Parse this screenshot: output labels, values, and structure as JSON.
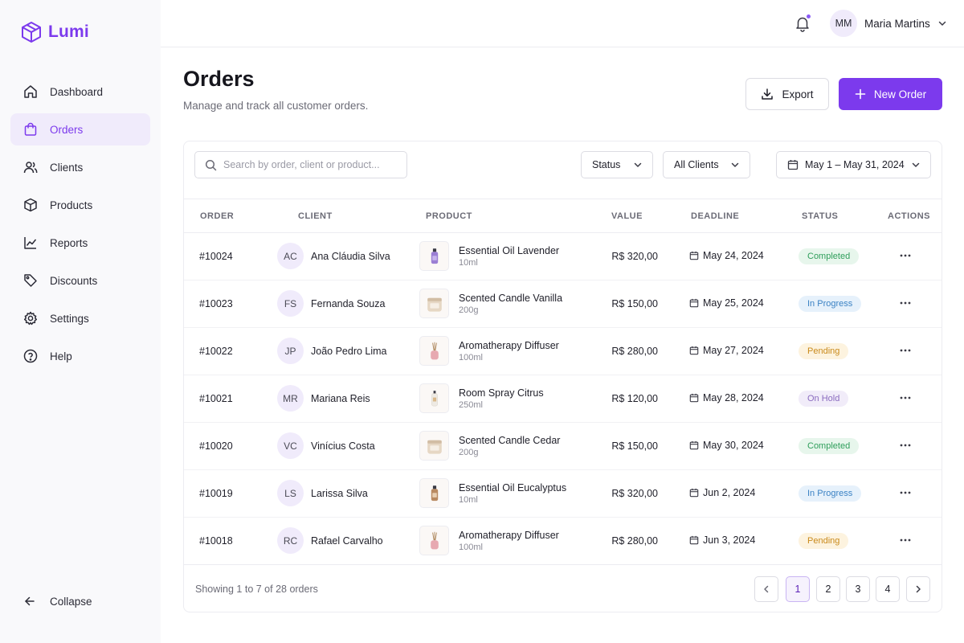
{
  "app": {
    "name": "Lumi"
  },
  "sidebar": {
    "items": [
      {
        "label": "Dashboard",
        "icon": "home-icon"
      },
      {
        "label": "Orders",
        "icon": "shopping-bag-icon",
        "active": true
      },
      {
        "label": "Clients",
        "icon": "users-icon"
      },
      {
        "label": "Products",
        "icon": "box-icon"
      },
      {
        "label": "Reports",
        "icon": "chart-icon"
      },
      {
        "label": "Discounts",
        "icon": "tag-icon"
      },
      {
        "label": "Settings",
        "icon": "gear-icon"
      },
      {
        "label": "Help",
        "icon": "help-circle-icon"
      }
    ],
    "collapse_label": "Collapse"
  },
  "header": {
    "user": {
      "initials": "MM",
      "name": "Maria Martins"
    }
  },
  "page": {
    "title": "Orders",
    "subtitle": "Manage and track all customer orders.",
    "export_label": "Export",
    "new_order_label": "New Order"
  },
  "filters": {
    "search_placeholder": "Search by order, client or product...",
    "status_label": "Status",
    "clients_label": "All Clients",
    "date_range": "May 1 – May 31, 2024"
  },
  "table": {
    "columns": [
      "ORDER",
      "CLIENT",
      "PRODUCT",
      "VALUE",
      "DEADLINE",
      "STATUS",
      "ACTIONS"
    ],
    "rows": [
      {
        "order": "#10024",
        "initials": "AC",
        "client": "Ana Cláudia Silva",
        "product": "Essential Oil Lavender",
        "size": "10ml",
        "value": "R$ 320,00",
        "deadline": "May 24, 2024",
        "status": "Completed",
        "thumb": "oil-lavender"
      },
      {
        "order": "#10023",
        "initials": "FS",
        "client": "Fernanda Souza",
        "product": "Scented Candle Vanilla",
        "size": "200g",
        "value": "R$ 150,00",
        "deadline": "May 25, 2024",
        "status": "In Progress",
        "thumb": "candle"
      },
      {
        "order": "#10022",
        "initials": "JP",
        "client": "João Pedro Lima",
        "product": "Aromatherapy Diffuser",
        "size": "100ml",
        "value": "R$ 280,00",
        "deadline": "May 27, 2024",
        "status": "Pending",
        "thumb": "diffuser"
      },
      {
        "order": "#10021",
        "initials": "MR",
        "client": "Mariana Reis",
        "product": "Room Spray Citrus",
        "size": "250ml",
        "value": "R$ 120,00",
        "deadline": "May 28, 2024",
        "status": "On Hold",
        "thumb": "spray"
      },
      {
        "order": "#10020",
        "initials": "VC",
        "client": "Vinícius Costa",
        "product": "Scented Candle Cedar",
        "size": "200g",
        "value": "R$ 150,00",
        "deadline": "May 30, 2024",
        "status": "Completed",
        "thumb": "candle"
      },
      {
        "order": "#10019",
        "initials": "LS",
        "client": "Larissa Silva",
        "product": "Essential Oil Eucalyptus",
        "size": "10ml",
        "value": "R$ 320,00",
        "deadline": "Jun 2, 2024",
        "status": "In Progress",
        "thumb": "oil-amber"
      },
      {
        "order": "#10018",
        "initials": "RC",
        "client": "Rafael Carvalho",
        "product": "Aromatherapy Diffuser",
        "size": "100ml",
        "value": "R$ 280,00",
        "deadline": "Jun 3, 2024",
        "status": "Pending",
        "thumb": "diffuser"
      }
    ]
  },
  "status_colors": {
    "Completed": {
      "bg": "#e7f6ec",
      "fg": "#2f9e5b"
    },
    "In Progress": {
      "bg": "#e6f1fb",
      "fg": "#3b82c4"
    },
    "Pending": {
      "bg": "#fdf3df",
      "fg": "#c98a1b"
    },
    "On Hold": {
      "bg": "#f1ecf9",
      "fg": "#8a6bbf"
    }
  },
  "pagination": {
    "summary": "Showing 1 to 7 of 28 orders",
    "pages": [
      "1",
      "2",
      "3",
      "4"
    ],
    "current": "1"
  },
  "colors": {
    "accent": "#7c3aed"
  }
}
